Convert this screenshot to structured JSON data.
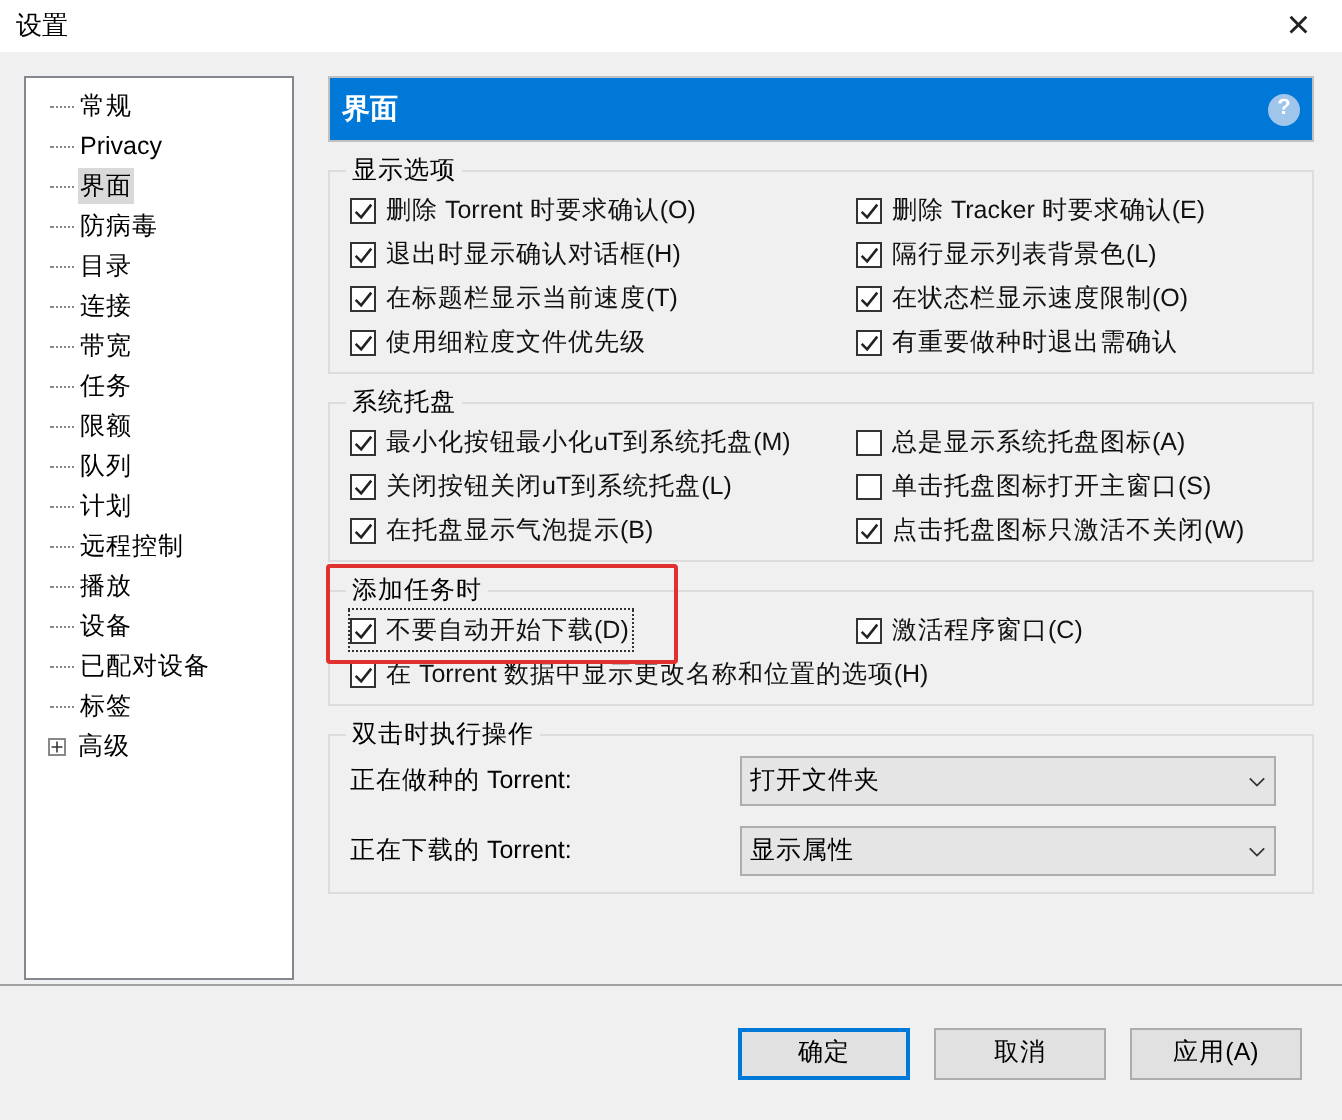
{
  "window": {
    "title": "设置",
    "close": "×"
  },
  "sidebar": {
    "items": [
      {
        "label": "常规",
        "selected": false
      },
      {
        "label": "Privacy",
        "selected": false
      },
      {
        "label": "界面",
        "selected": true
      },
      {
        "label": "防病毒",
        "selected": false
      },
      {
        "label": "目录",
        "selected": false
      },
      {
        "label": "连接",
        "selected": false
      },
      {
        "label": "带宽",
        "selected": false
      },
      {
        "label": "任务",
        "selected": false
      },
      {
        "label": "限额",
        "selected": false
      },
      {
        "label": "队列",
        "selected": false
      },
      {
        "label": "计划",
        "selected": false
      },
      {
        "label": "远程控制",
        "selected": false
      },
      {
        "label": "播放",
        "selected": false
      },
      {
        "label": "设备",
        "selected": false
      },
      {
        "label": "已配对设备",
        "selected": false
      },
      {
        "label": "标签",
        "selected": false
      },
      {
        "label": "高级",
        "selected": false,
        "expanded": false
      }
    ]
  },
  "header": {
    "title": "界面",
    "help": "?"
  },
  "sections": [
    {
      "title": "显示选项",
      "highlighted": false,
      "rows": [
        [
          {
            "label": "删除 Torrent 时要求确认(O)",
            "checked": true,
            "focused": false
          },
          {
            "label": "删除 Tracker 时要求确认(E)",
            "checked": true,
            "focused": false
          }
        ],
        [
          {
            "label": "退出时显示确认对话框(H)",
            "checked": true,
            "focused": false
          },
          {
            "label": "隔行显示列表背景色(L)",
            "checked": true,
            "focused": false
          }
        ],
        [
          {
            "label": "在标题栏显示当前速度(T)",
            "checked": true,
            "focused": false
          },
          {
            "label": "在状态栏显示速度限制(O)",
            "checked": true,
            "focused": false
          }
        ],
        [
          {
            "label": "使用细粒度文件优先级",
            "checked": true,
            "focused": false
          },
          {
            "label": "有重要做种时退出需确认",
            "checked": true,
            "focused": false
          }
        ]
      ]
    },
    {
      "title": "系统托盘",
      "highlighted": false,
      "rows": [
        [
          {
            "label": "最小化按钮最小化uT到系统托盘(M)",
            "checked": true,
            "focused": false
          },
          {
            "label": "总是显示系统托盘图标(A)",
            "checked": false,
            "focused": false
          }
        ],
        [
          {
            "label": "关闭按钮关闭uT到系统托盘(L)",
            "checked": true,
            "focused": false
          },
          {
            "label": "单击托盘图标打开主窗口(S)",
            "checked": false,
            "focused": false
          }
        ],
        [
          {
            "label": "在托盘显示气泡提示(B)",
            "checked": true,
            "focused": false
          },
          {
            "label": "点击托盘图标只激活不关闭(W)",
            "checked": true,
            "focused": false
          }
        ]
      ]
    },
    {
      "title": "添加任务时",
      "highlighted": true,
      "rows": [
        [
          {
            "label": "不要自动开始下载(D)",
            "checked": true,
            "focused": true
          },
          {
            "label": "激活程序窗口(C)",
            "checked": true,
            "focused": false
          }
        ],
        [
          {
            "label": "在 Torrent 数据中显示更改名称和位置的选项(H)",
            "checked": true,
            "focused": false
          }
        ]
      ]
    }
  ],
  "double_click": {
    "title": "双击时执行操作",
    "rows": [
      {
        "label": "正在做种的 Torrent:",
        "value": "打开文件夹"
      },
      {
        "label": "正在下载的 Torrent:",
        "value": "显示属性"
      }
    ]
  },
  "buttons": [
    {
      "label": "确定",
      "default": true
    },
    {
      "label": "取消",
      "default": false
    },
    {
      "label": "应用(A)",
      "default": false
    }
  ]
}
